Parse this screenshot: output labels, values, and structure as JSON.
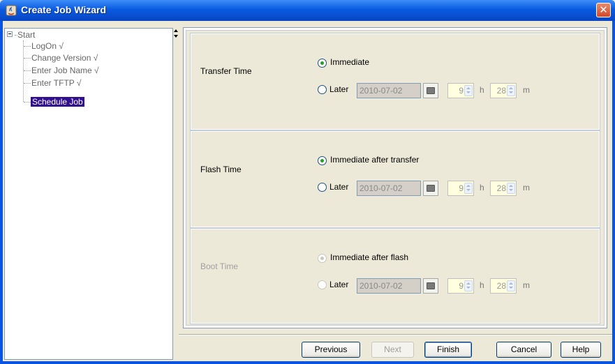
{
  "window": {
    "title": "Create Job Wizard",
    "close_glyph": "✕"
  },
  "tree": {
    "root": "Start",
    "items": [
      {
        "label": "LogOn √"
      },
      {
        "label": "Change Version √"
      },
      {
        "label": "Enter Job Name √"
      },
      {
        "label": "Enter TFTP √"
      },
      {
        "label": "Schedule Job",
        "selected": true
      }
    ]
  },
  "sections": [
    {
      "label": "Transfer Time",
      "immediate_label": "Immediate",
      "later_label": "Later",
      "date": "2010-07-02",
      "hour": "9",
      "hour_unit": "h",
      "minute": "28",
      "minute_unit": "m",
      "selected": "immediate",
      "enabled": true
    },
    {
      "label": "Flash Time",
      "immediate_label": "Immediate after transfer",
      "later_label": "Later",
      "date": "2010-07-02",
      "hour": "9",
      "hour_unit": "h",
      "minute": "28",
      "minute_unit": "m",
      "selected": "immediate",
      "enabled": true
    },
    {
      "label": "Boot Time",
      "immediate_label": "Immediate after flash",
      "later_label": "Later",
      "date": "2010-07-02",
      "hour": "9",
      "hour_unit": "h",
      "minute": "28",
      "minute_unit": "m",
      "selected": "immediate",
      "enabled": false
    }
  ],
  "buttons": {
    "previous": "Previous",
    "next": "Next",
    "finish": "Finish",
    "cancel": "Cancel",
    "help": "Help"
  },
  "colors": {
    "titlebar": "#0A5AE0",
    "selection": "#31108F",
    "radio_checked": "#21A121",
    "spinner_bg": "#FFFFE0"
  }
}
